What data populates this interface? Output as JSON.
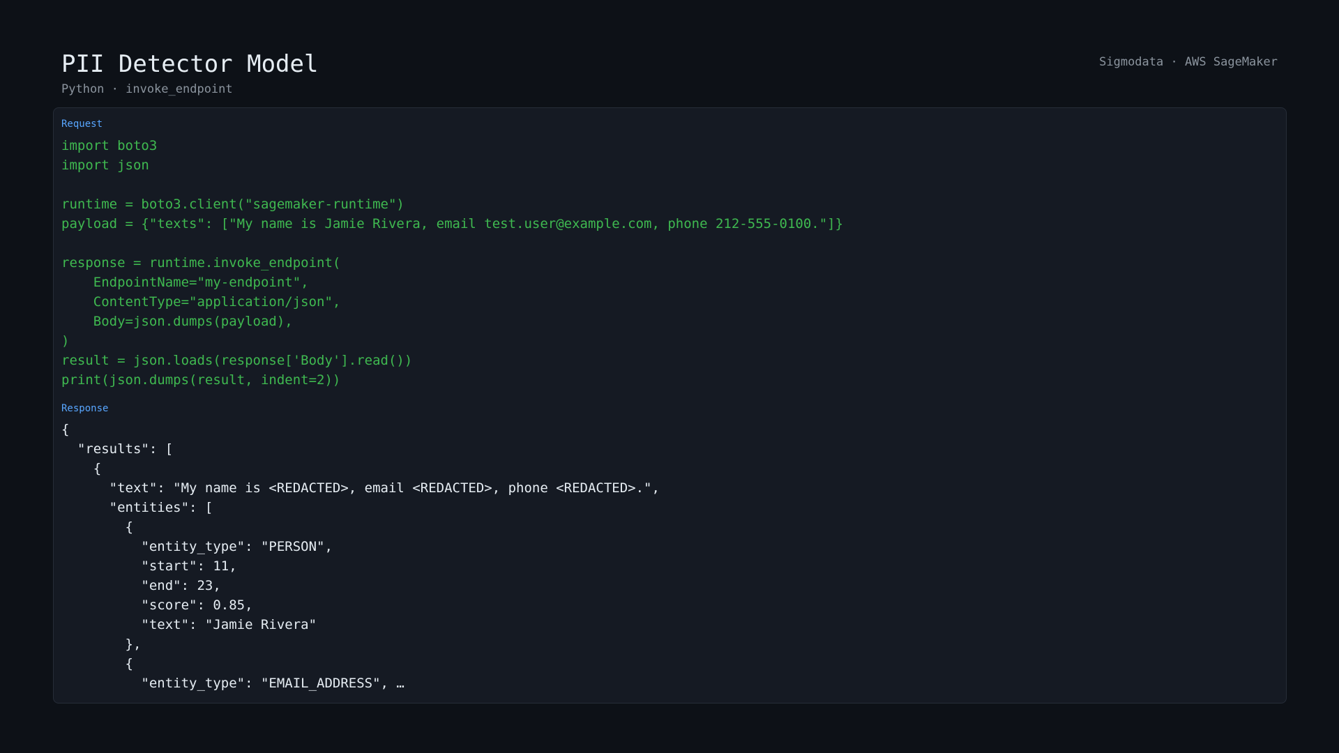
{
  "header": {
    "title": "PII Detector Model",
    "subtitle": "Python · invoke_endpoint",
    "brand": "Sigmodata · AWS SageMaker"
  },
  "request": {
    "label": "Request",
    "code": "import boto3\nimport json\n\nruntime = boto3.client(\"sagemaker-runtime\")\npayload = {\"texts\": [\"My name is Jamie Rivera, email test.user@example.com, phone 212-555-0100.\"]}\n\nresponse = runtime.invoke_endpoint(\n    EndpointName=\"my-endpoint\",\n    ContentType=\"application/json\",\n    Body=json.dumps(payload),\n)\nresult = json.loads(response['Body'].read())\nprint(json.dumps(result, indent=2))"
  },
  "response": {
    "label": "Response",
    "code": "{\n  \"results\": [\n    {\n      \"text\": \"My name is <REDACTED>, email <REDACTED>, phone <REDACTED>.\",\n      \"entities\": [\n        {\n          \"entity_type\": \"PERSON\",\n          \"start\": 11,\n          \"end\": 23,\n          \"score\": 0.85,\n          \"text\": \"Jamie Rivera\"\n        },\n        {\n          \"entity_type\": \"EMAIL_ADDRESS\", …"
  },
  "colors": {
    "background": "#0d1117",
    "panel": "#151a23",
    "section_label": "#58a6ff",
    "request_code": "#3fb950",
    "response_code": "#e6edf3",
    "muted_text": "#8b949e"
  }
}
